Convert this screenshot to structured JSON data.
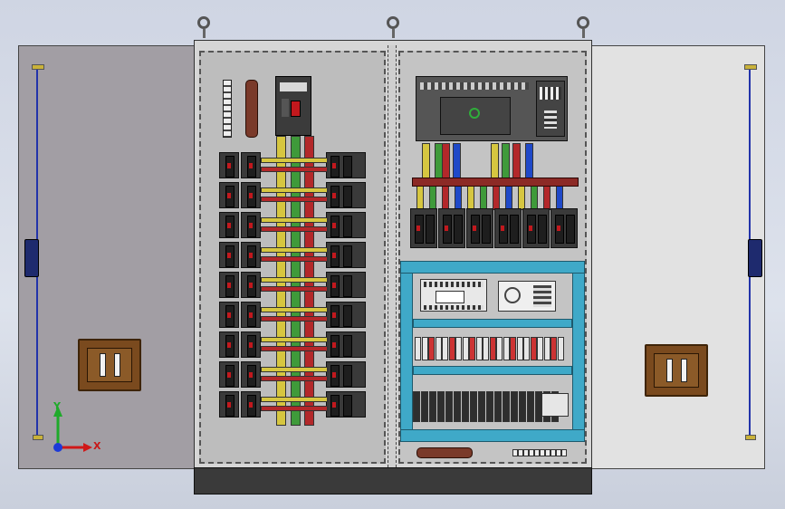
{
  "axes": {
    "x_label": "X",
    "y_label": "Y"
  },
  "colors": {
    "left_door": "#a29ea4",
    "right_door": "#e2e2e2",
    "cabinet_inner": "#cbcbcb",
    "mounting_plate": "#bdbdbd",
    "base": "#3a3a3a",
    "rail": "#3fa9c8",
    "handle": "#7a4a1e",
    "rod": "#2233aa",
    "bus_yellow": "#d6c640",
    "bus_green": "#3f9a3a",
    "bus_red": "#b3282a",
    "bus_blue": "#1f49c8"
  },
  "icons": {
    "lifting_eye": "lifting-eye-icon",
    "coordinate_triad": "coordinate-triad-icon",
    "door_handle": "door-handle-icon"
  }
}
